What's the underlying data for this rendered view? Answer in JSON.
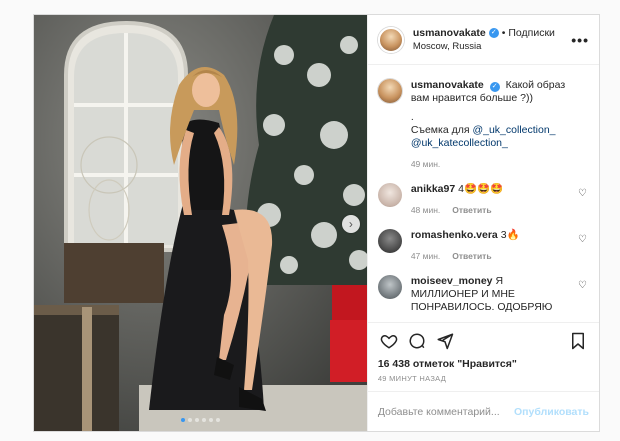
{
  "post": {
    "username": "usmanovakate",
    "follow_label": "• Подписки",
    "location": "Moscow, Russia",
    "more_label": "•••",
    "caption": {
      "username": "usmanovakate",
      "text": "Какой образ вам нравится больше ?))",
      "line2": ".",
      "line3_prefix": "Съемка для ",
      "mention1": "@_uk_collection_",
      "mention2": "@uk_katecollection_",
      "time": "49 мин."
    },
    "comments": [
      {
        "username": "anikka97",
        "text": "4🤩🤩🤩",
        "time": "48 мин.",
        "reply": "Ответить"
      },
      {
        "username": "romashenko.vera",
        "text": "3🔥",
        "time": "47 мин.",
        "reply": "Ответить"
      },
      {
        "username": "moiseev_money",
        "text": "Я МИЛЛИОНЕР И МНЕ ПОНРАВИЛОСЬ. ОДОБРЯЮ",
        "time": "",
        "reply": ""
      }
    ],
    "likes": "16 438 отметок \"Нравится\"",
    "time_ago": "49 МИНУТ НАЗАД",
    "add_comment_placeholder": "Добавьте комментарий...",
    "publish_label": "Опубликовать",
    "carousel_total": 6,
    "carousel_active": 1
  },
  "colors": {
    "accent": "#3897f0",
    "publish": "#b2dffc",
    "muted": "#8e8e8e"
  }
}
